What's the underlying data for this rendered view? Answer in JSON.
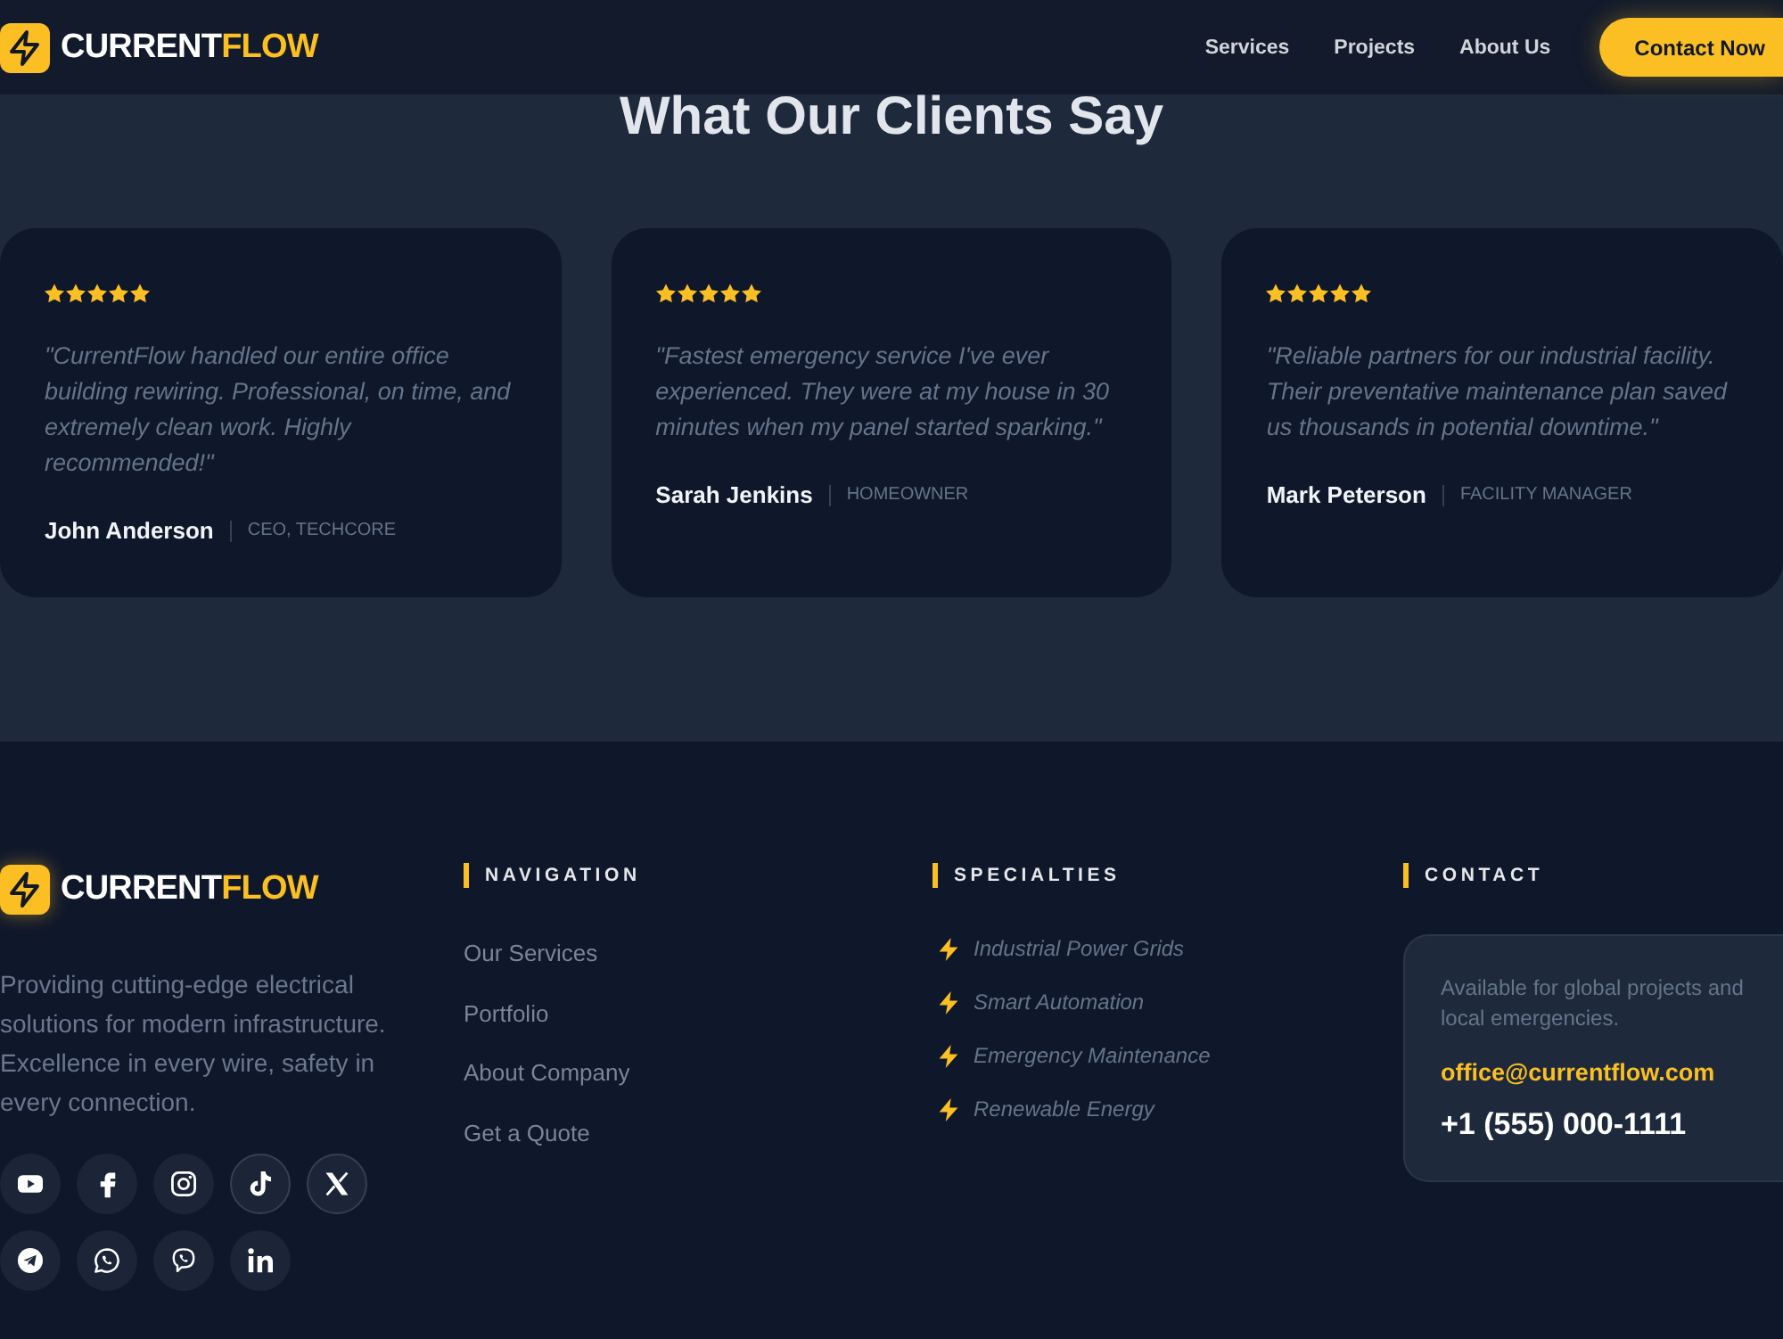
{
  "header": {
    "brand": {
      "name": "CURRENT",
      "accent": "FLOW"
    },
    "nav": [
      "Services",
      "Projects",
      "About Us"
    ],
    "cta": "Contact Now"
  },
  "testimonials": {
    "heading": "What Our Clients Say",
    "items": [
      {
        "stars": 5,
        "quote": "\"CurrentFlow handled our entire office building rewiring. Professional, on time, and extremely clean work. Highly recommended!\"",
        "name": "John Anderson",
        "role": "CEO, TECHCORE"
      },
      {
        "stars": 5,
        "quote": "\"Fastest emergency service I've ever experienced. They were at my house in 30 minutes when my panel started sparking.\"",
        "name": "Sarah Jenkins",
        "role": "HOMEOWNER"
      },
      {
        "stars": 5,
        "quote": "\"Reliable partners for our industrial facility. Their preventative maintenance plan saved us thousands in potential downtime.\"",
        "name": "Mark Peterson",
        "role": "FACILITY MANAGER"
      }
    ]
  },
  "footer": {
    "brand": {
      "name": "CURRENT",
      "accent": "FLOW"
    },
    "description": "Providing cutting-edge electrical solutions for modern infrastructure. Excellence in every wire, safety in every connection.",
    "socials": [
      {
        "kind": "youtube",
        "outlined": false
      },
      {
        "kind": "facebook",
        "outlined": false
      },
      {
        "kind": "instagram",
        "outlined": false
      },
      {
        "kind": "tiktok",
        "outlined": true
      },
      {
        "kind": "x",
        "outlined": true
      },
      {
        "kind": "telegram",
        "outlined": false
      },
      {
        "kind": "whatsapp",
        "outlined": false
      },
      {
        "kind": "viber",
        "outlined": false
      },
      {
        "kind": "linkedin",
        "outlined": false
      }
    ],
    "navigation": {
      "title": "NAVIGATION",
      "links": [
        "Our Services",
        "Portfolio",
        "About Company",
        "Get a Quote"
      ]
    },
    "specialties": {
      "title": "SPECIALTIES",
      "items": [
        "Industrial Power Grids",
        "Smart Automation",
        "Emergency Maintenance",
        "Renewable Energy"
      ]
    },
    "contact": {
      "title": "CONTACT",
      "note": "Available for global projects and local emergencies.",
      "email": "office@currentflow.com",
      "phone": "+1 (555) 000-1111"
    }
  }
}
